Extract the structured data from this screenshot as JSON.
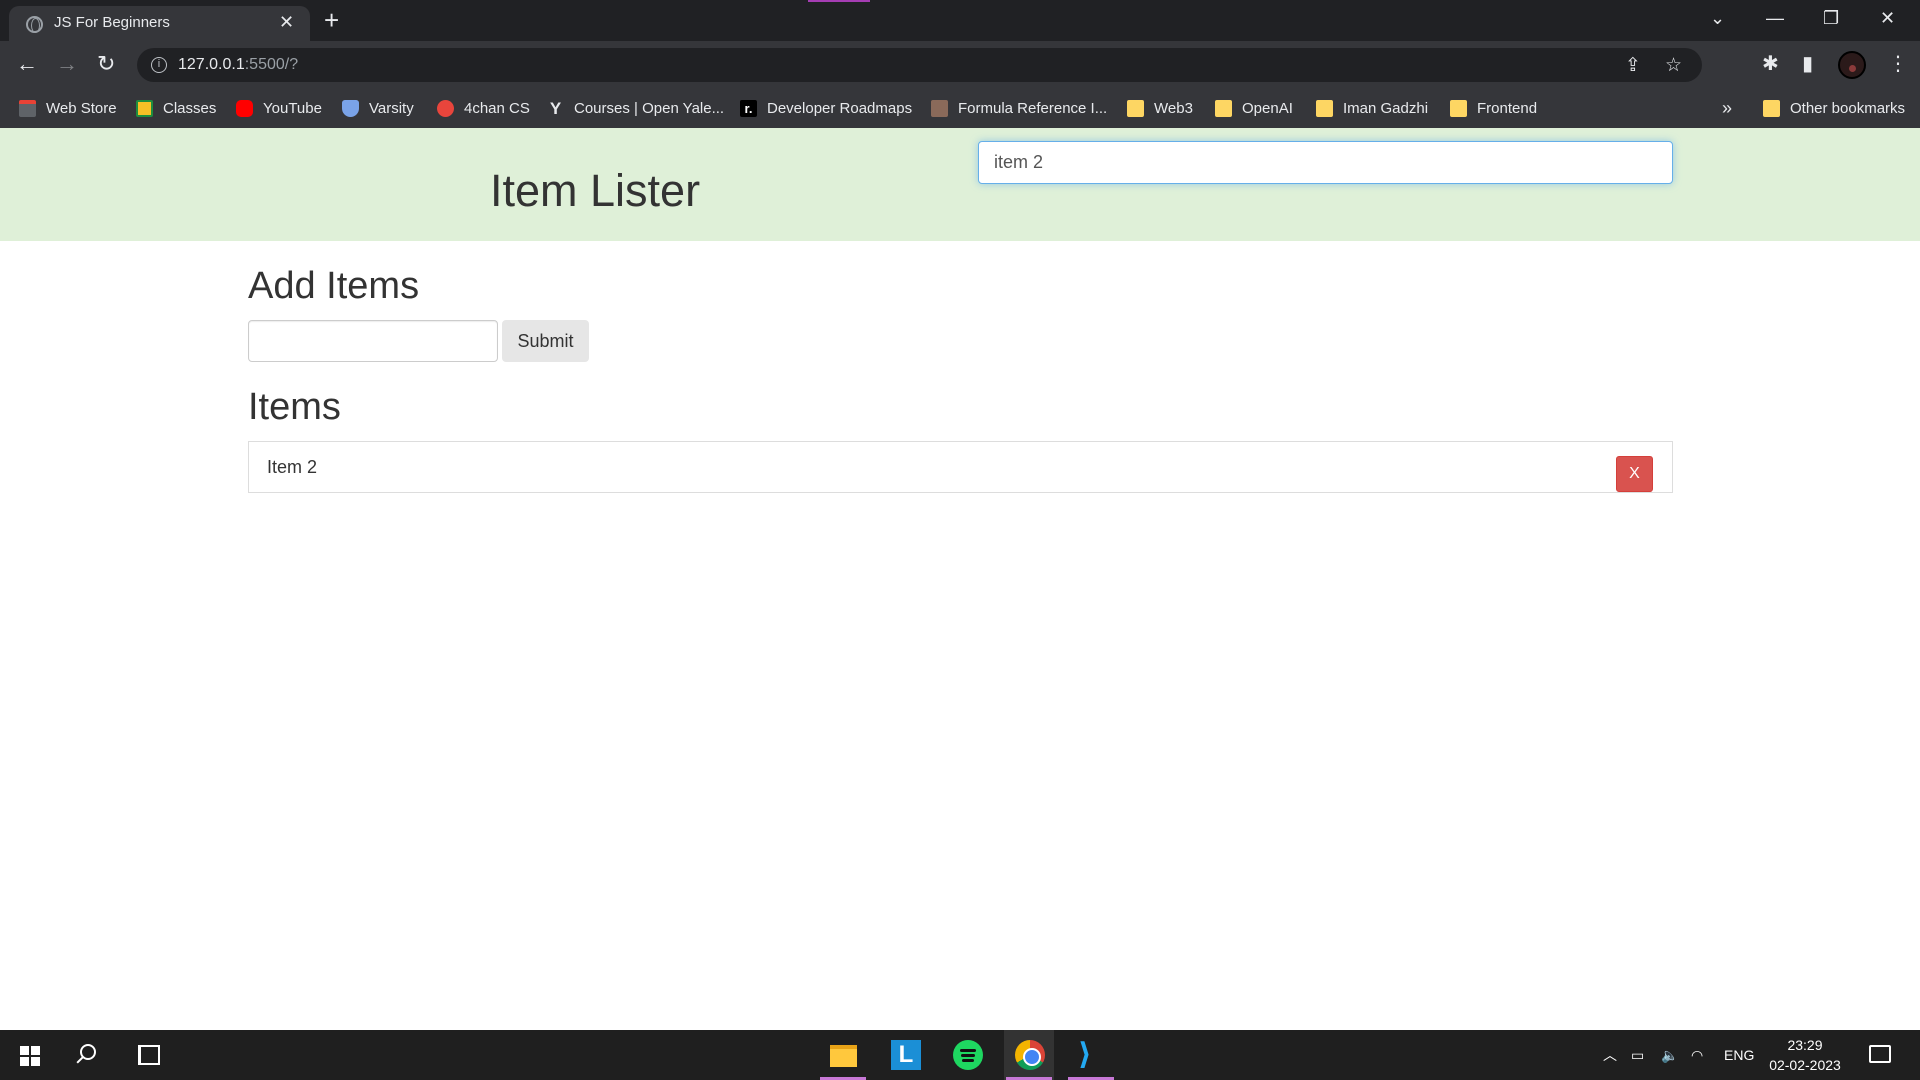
{
  "browser": {
    "tab_title": "JS For Beginners",
    "tab_close": "✕",
    "new_tab": "+",
    "url_host": "127.0.0.1",
    "url_rest": ":5500/?",
    "win_controls": {
      "tabsearch": "⌄",
      "minimize": "—",
      "restore": "❐",
      "close": "✕"
    },
    "nav": {
      "back": "←",
      "forward": "→",
      "reload": "↻"
    },
    "bookmarks": [
      {
        "label": "Web Store",
        "icon": "webstore-icon"
      },
      {
        "label": "Classes",
        "icon": "classes-icon"
      },
      {
        "label": "YouTube",
        "icon": "youtube-icon"
      },
      {
        "label": "Varsity",
        "icon": "shield-icon"
      },
      {
        "label": "4chan CS",
        "icon": "fire-icon"
      },
      {
        "label": "Courses | Open Yale...",
        "icon": "yale-icon"
      },
      {
        "label": "Developer Roadmaps",
        "icon": "roadmap-icon"
      },
      {
        "label": "Formula Reference I...",
        "icon": "person-icon"
      },
      {
        "label": "Web3",
        "icon": "folder-icon"
      },
      {
        "label": "OpenAI",
        "icon": "folder-icon"
      },
      {
        "label": "Iman Gadzhi",
        "icon": "folder-icon"
      },
      {
        "label": "Frontend",
        "icon": "folder-icon"
      }
    ],
    "bookmarks_more": "»",
    "other_bookmarks": "Other bookmarks"
  },
  "page": {
    "header_title": "Item Lister",
    "filter_value": "item 2",
    "add_heading": "Add Items",
    "add_input_value": "",
    "submit_label": "Submit",
    "items_heading": "Items",
    "items": [
      {
        "text": "Item 2",
        "delete_label": "X"
      }
    ]
  },
  "taskbar": {
    "language": "ENG",
    "time": "23:29",
    "date": "02-02-2023",
    "apps": [
      "file-explorer",
      "l-app",
      "spotify",
      "chrome",
      "vscode"
    ]
  },
  "colors": {
    "header_bg": "#dff0d8",
    "delete_btn": "#d9534f",
    "chrome_dark": "#202124",
    "chrome_toolbar": "#35363a"
  }
}
